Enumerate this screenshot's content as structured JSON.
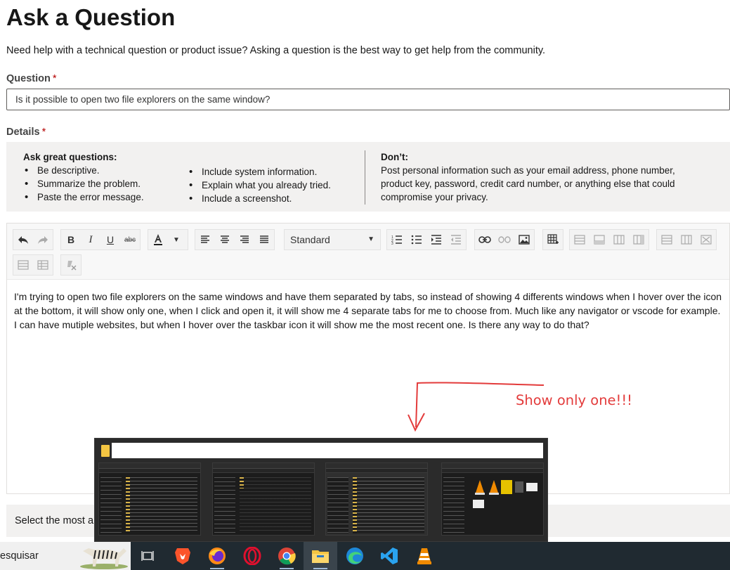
{
  "page": {
    "title": "Ask a Question",
    "intro": "Need help with a technical question or product issue? Asking a question is the best way to get help from the community."
  },
  "question": {
    "label": "Question",
    "required_mark": "*",
    "value": "Is it possible to open two file explorers on the same window?"
  },
  "details": {
    "label": "Details",
    "required_mark": "*"
  },
  "tips": {
    "ask_heading": "Ask great questions:",
    "ask_col1": [
      "Be descriptive.",
      "Summarize the problem.",
      "Paste the error message."
    ],
    "ask_col2": [
      "Include system information.",
      "Explain what you already tried.",
      "Include a screenshot."
    ],
    "dont_heading": "Don’t:",
    "dont_text": "Post personal information such as your email address, phone number, product key, password, credit card number, or anything else that could compromise your privacy."
  },
  "editor": {
    "format_select": "Standard",
    "body": "I'm trying to open two file explorers on the same windows and have them separated by tabs, so instead of showing 4 differents windows when I hover over the icon at the bottom, it will show only one, when I click and open it, it will show me 4 separate tabs for me to choose from. Much like any navigator or vscode for example. I can have mutiple websites, but when I hover over the taskbar icon it will show me the most recent one. Is there any way to do that?"
  },
  "annotation": {
    "text": "Show only one!!!",
    "color": "#e33b3b"
  },
  "banner": {
    "text": "Select the most a"
  },
  "taskbar": {
    "search_text": "esquisar",
    "icons": [
      "task-view-icon",
      "brave-icon",
      "firefox-icon",
      "opera-icon",
      "chrome-icon",
      "file-explorer-icon",
      "edge-icon",
      "vscode-icon",
      "vlc-icon"
    ]
  },
  "colors": {
    "taskbar": "#202a31",
    "tips_bg": "#f2f1f0",
    "required": "#b40000"
  }
}
